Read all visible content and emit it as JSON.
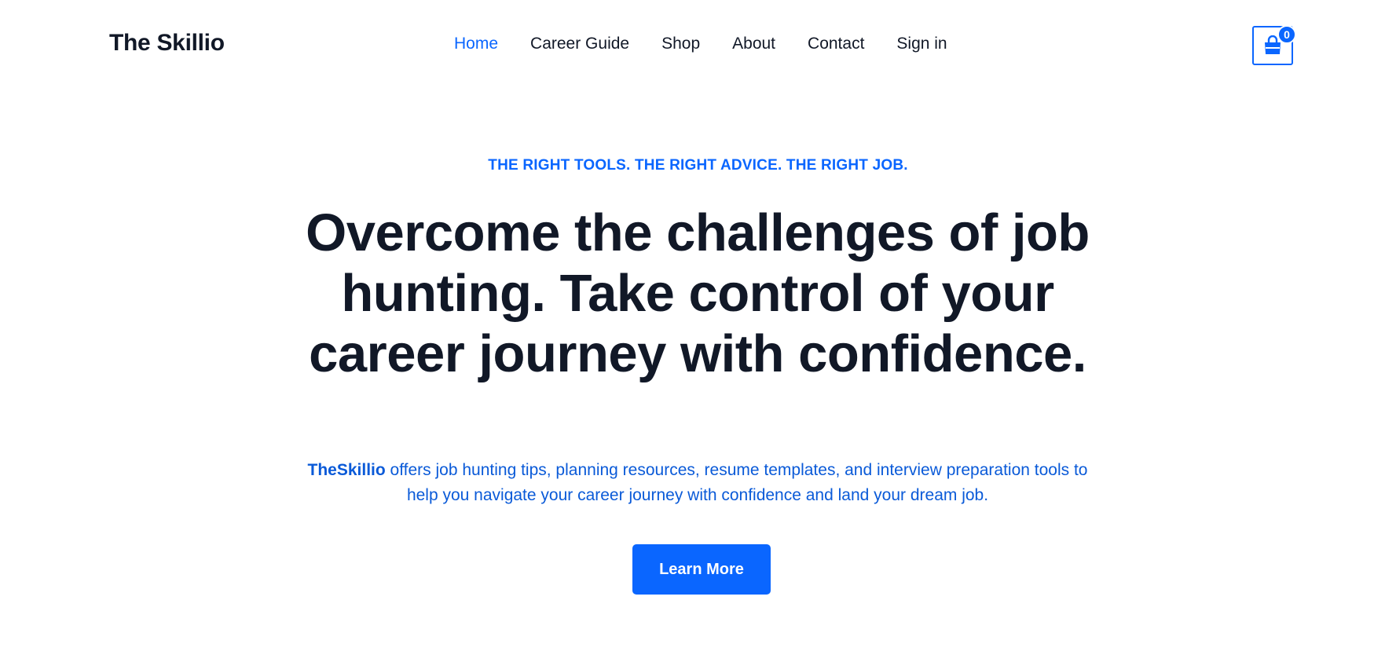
{
  "header": {
    "logo": "The Skillio",
    "nav": [
      {
        "label": "Home",
        "active": true
      },
      {
        "label": "Career Guide",
        "active": false
      },
      {
        "label": "Shop",
        "active": false
      },
      {
        "label": "About",
        "active": false
      },
      {
        "label": "Contact",
        "active": false
      },
      {
        "label": "Sign in",
        "active": false
      }
    ],
    "cart": {
      "icon": "shopping-bag-icon",
      "count": "0"
    }
  },
  "hero": {
    "eyebrow": "THE RIGHT TOOLS. THE RIGHT ADVICE. THE RIGHT JOB.",
    "headline": "Overcome the challenges of job hunting. Take control of your career journey with confidence.",
    "description_brand": "TheSkillio",
    "description_text": " offers job hunting tips, planning resources, resume templates, and interview preparation tools to help you navigate your career journey with confidence and land your dream job.",
    "cta_label": "Learn More"
  },
  "colors": {
    "accent": "#0a66ff",
    "text_dark": "#111827",
    "background": "#ffffff"
  }
}
